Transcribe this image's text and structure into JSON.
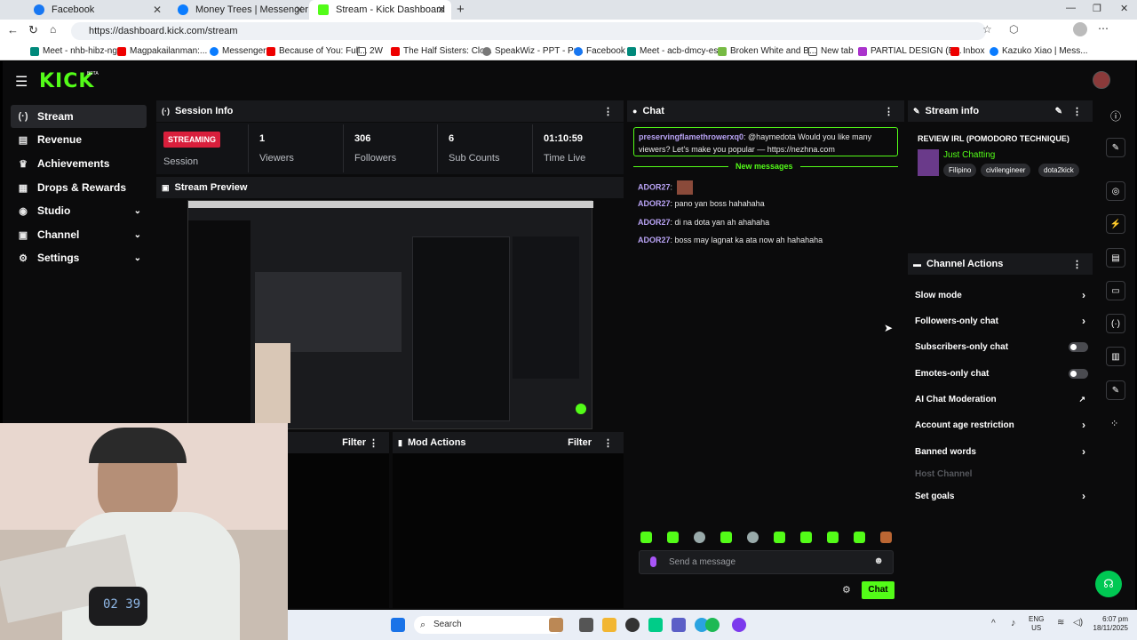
{
  "browser": {
    "tabs": [
      {
        "label": "Facebook",
        "color": "#1877f2"
      },
      {
        "label": "Money Trees | Messenger",
        "color": "#0a7cff"
      },
      {
        "label": "Stream - Kick Dashboard",
        "color": "#53fc18"
      }
    ],
    "url": "https://dashboard.kick.com/stream",
    "bookmarks": [
      "Meet - nhb-hibz-nga",
      "Magpakailanman:...",
      "Messenger",
      "Because of You: Full...",
      "2W",
      "The Half Sisters: Clo...",
      "SpeakWiz - PPT - Pr...",
      "Facebook",
      "Meet - acb-dmcy-es...",
      "Broken White and B...",
      "New tab",
      "PARTIAL DESIGN (B...",
      "Inbox",
      "Kazuko Xiao | Mess..."
    ]
  },
  "app": {
    "logo": "KICK",
    "logo_badge": "BETA",
    "accent": "#53fc18"
  },
  "sidebar": {
    "items": [
      {
        "label": "Stream",
        "icon": "stream-icon"
      },
      {
        "label": "Revenue",
        "icon": "revenue-icon"
      },
      {
        "label": "Achievements",
        "icon": "trophy-icon"
      },
      {
        "label": "Drops & Rewards",
        "icon": "gift-icon"
      },
      {
        "label": "Studio",
        "icon": "studio-icon"
      },
      {
        "label": "Channel",
        "icon": "channel-icon"
      },
      {
        "label": "Settings",
        "icon": "gear-icon"
      }
    ]
  },
  "session": {
    "title": "Session Info",
    "badge": "STREAMING",
    "session_label": "Session",
    "stats": [
      {
        "value": "1",
        "label": "Viewers"
      },
      {
        "value": "306",
        "label": "Followers"
      },
      {
        "value": "6",
        "label": "Sub Counts"
      },
      {
        "value": "01:10:59",
        "label": "Time Live"
      }
    ]
  },
  "preview": {
    "title": "Stream Preview"
  },
  "lower": {
    "filter_label": "Filter",
    "mod_actions": "Mod Actions",
    "filter2": "Filter"
  },
  "chat": {
    "title": "Chat",
    "pinned_user": "preservingflamethrowerxq0",
    "pinned_text": ": @haymedota Would you like many viewers? Let's make you popular — https://nezhna.com",
    "new_messages": "New messages",
    "messages": [
      {
        "user": "ADOR27",
        "text": ":"
      },
      {
        "user": "ADOR27",
        "text": ": pano yan boss hahahaha"
      },
      {
        "user": "ADOR27",
        "text": ": di na dota yan ah ahahaha"
      },
      {
        "user": "ADOR27",
        "text": ": boss may lagnat ka ata now ah hahahaha"
      }
    ],
    "placeholder": "Send a message",
    "send": "Chat"
  },
  "stream_info": {
    "title": "Stream info",
    "stream_title": "REVIEW IRL (POMODORO TECHNIQUE)",
    "category": "Just Chatting",
    "tags": [
      "Filipino",
      "civilengineer",
      "dota2kick"
    ]
  },
  "channel_actions": {
    "title": "Channel Actions",
    "items": [
      {
        "label": "Slow mode",
        "control": "chevron"
      },
      {
        "label": "Followers-only chat",
        "control": "chevron"
      },
      {
        "label": "Subscribers-only chat",
        "control": "toggle"
      },
      {
        "label": "Emotes-only chat",
        "control": "toggle"
      },
      {
        "label": "AI Chat Moderation",
        "control": "external"
      },
      {
        "label": "Account age restriction",
        "control": "chevron"
      },
      {
        "label": "Banned words",
        "control": "chevron"
      },
      {
        "label": "Host Channel",
        "control": "none"
      },
      {
        "label": "Set goals",
        "control": "chevron"
      }
    ]
  },
  "webcam": {
    "clock": "02 39"
  },
  "taskbar": {
    "search": "Search",
    "lang1": "ENG",
    "lang2": "US",
    "time": "6:07 pm",
    "date": "18/11/2025"
  }
}
